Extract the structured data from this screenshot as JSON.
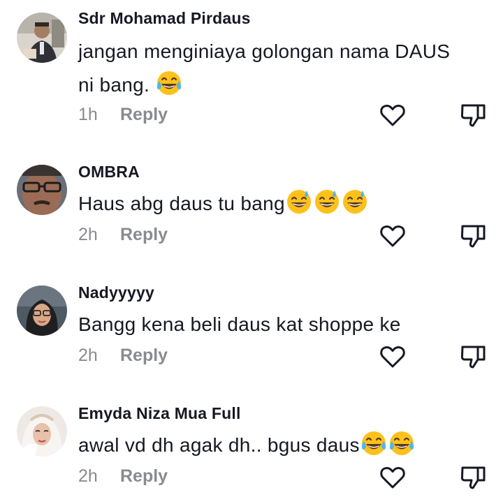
{
  "comments": [
    {
      "username": "Sdr Mohamad Pirdaus",
      "text_line1": "jangan menginiaya golongan nama DAUS",
      "text_line2": "ni bang.",
      "emojis": [
        "face-with-tears-of-joy-icon"
      ],
      "time": "1h",
      "reply_label": "Reply"
    },
    {
      "username": "OMBRA",
      "text": "Haus abg daus tu bang",
      "emojis": [
        "grinning-sweat-icon",
        "grinning-sweat-icon",
        "grinning-sweat-icon"
      ],
      "time": "2h",
      "reply_label": "Reply"
    },
    {
      "username": "Nadyyyyy",
      "text": "Bangg kena beli daus kat shoppe ke",
      "time": "2h",
      "reply_label": "Reply"
    },
    {
      "username": "Emyda Niza Mua Full",
      "text": "awal vd dh agak dh.. bgus daus",
      "emojis": [
        "face-with-tears-of-joy-icon",
        "face-with-tears-of-joy-icon"
      ],
      "time": "2h",
      "reply_label": "Reply"
    }
  ],
  "icons": {
    "like": "heart-outline-icon",
    "dislike": "thumbs-down-outline-icon"
  },
  "colors": {
    "text": "#161823",
    "meta": "#8a8b91",
    "icon": "#161823"
  }
}
